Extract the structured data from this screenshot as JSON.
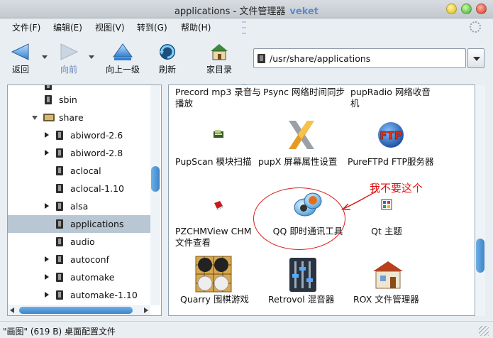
{
  "window": {
    "title": "applications - 文件管理器",
    "app_name": "veket"
  },
  "menu": [
    "文件(F)",
    "编辑(E)",
    "视图(V)",
    "转到(G)",
    "帮助(H)"
  ],
  "toolbar": {
    "back": "返回",
    "forward": "向前",
    "up": "向上一级",
    "refresh": "刷新",
    "home": "家目录"
  },
  "location": {
    "path": "/usr/share/applications"
  },
  "tree": {
    "items": [
      {
        "label": "sbin",
        "expander": "none",
        "icon": "folder"
      },
      {
        "label": "share",
        "expander": "expanded",
        "icon": "folder-open"
      },
      {
        "label": "abiword-2.6",
        "expander": "collapsed",
        "icon": "folder"
      },
      {
        "label": "abiword-2.8",
        "expander": "collapsed",
        "icon": "folder"
      },
      {
        "label": "aclocal",
        "expander": "none",
        "icon": "folder"
      },
      {
        "label": "aclocal-1.10",
        "expander": "none",
        "icon": "folder"
      },
      {
        "label": "alsa",
        "expander": "collapsed",
        "icon": "folder"
      },
      {
        "label": "applications",
        "expander": "none",
        "icon": "folder",
        "selected": true
      },
      {
        "label": "audio",
        "expander": "none",
        "icon": "folder"
      },
      {
        "label": "autoconf",
        "expander": "collapsed",
        "icon": "folder"
      },
      {
        "label": "automake",
        "expander": "collapsed",
        "icon": "folder"
      },
      {
        "label": "automake-1.10",
        "expander": "collapsed",
        "icon": "folder"
      }
    ]
  },
  "apps": [
    {
      "label": "Precord mp3 录音与播放",
      "icon": "none"
    },
    {
      "label": "Psync 网络时间同步",
      "icon": "none"
    },
    {
      "label": "pupRadio 网络收音机",
      "icon": "none"
    },
    {
      "label": "PupScan 模块扫描",
      "icon": "scanner-icon"
    },
    {
      "label": "pupX 屏幕属性设置",
      "icon": "x-icon"
    },
    {
      "label": "PureFTPd FTP服务器",
      "icon": "ftp-globe-icon"
    },
    {
      "label": "PZCHMView CHM 文件查看",
      "icon": "book-icon"
    },
    {
      "label": "QQ 即时通讯工具",
      "icon": "qq-chat-icon"
    },
    {
      "label": "Qt 主题",
      "icon": "qt-grid-icon"
    },
    {
      "label": "Quarry 围棋游戏",
      "icon": "go-board-icon"
    },
    {
      "label": "Retrovol 混音器",
      "icon": "mixer-icon"
    },
    {
      "label": "ROX 文件管理器",
      "icon": "house-icon"
    }
  ],
  "annotation": {
    "text": "我不要这个",
    "color": "#e01010"
  },
  "status": {
    "text": "\"画图\" (619 B) 桌面配置文件"
  }
}
